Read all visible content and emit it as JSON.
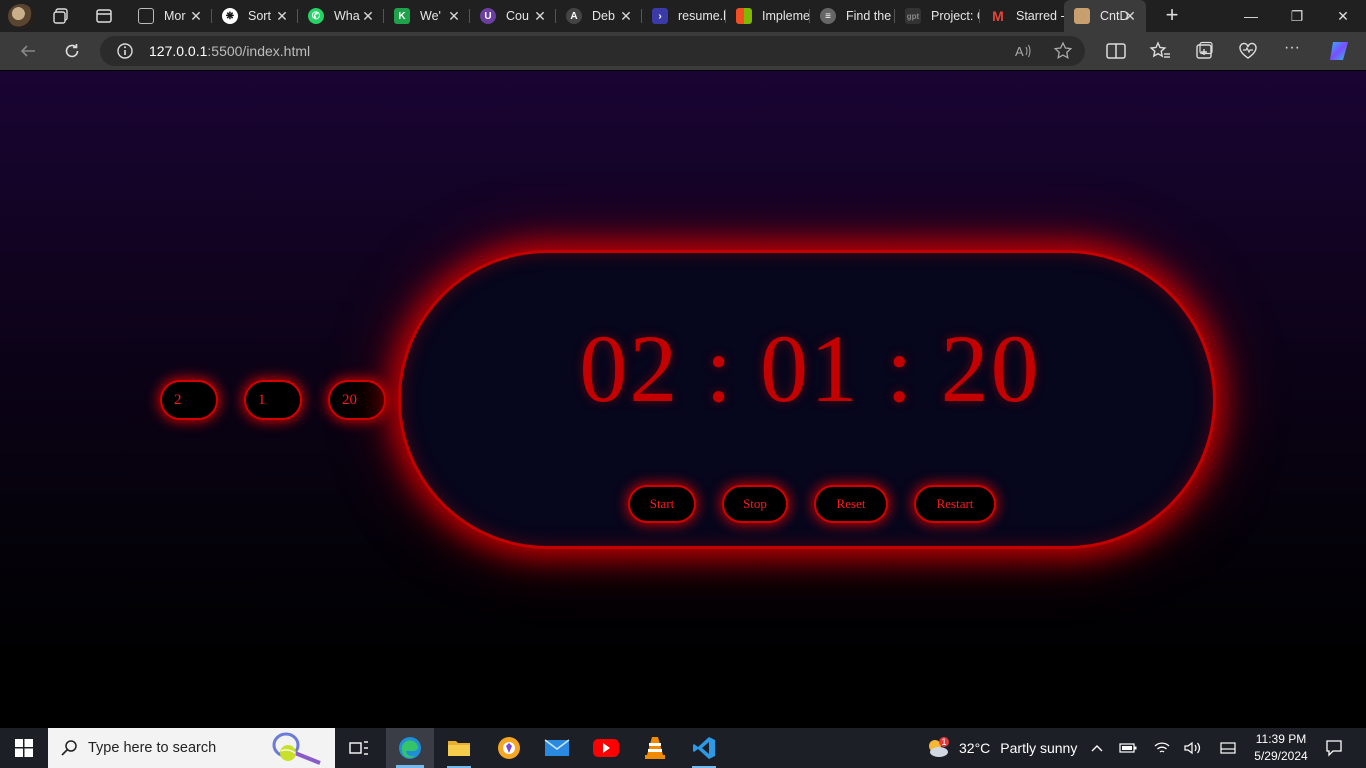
{
  "browser": {
    "tabs": [
      {
        "title": "Mor",
        "icon": "document-icon",
        "color": "#2b2b2b"
      },
      {
        "title": "Sort",
        "icon": "chatgpt-icon",
        "color": "#ffffff"
      },
      {
        "title": "Wha",
        "icon": "whatsapp-icon",
        "color": "#25d366"
      },
      {
        "title": "We'",
        "icon": "brand-icon",
        "color": "#1fa34a"
      },
      {
        "title": "Cou",
        "icon": "shield-icon",
        "color": "#6b3fa0"
      },
      {
        "title": "Deb",
        "icon": "a-logo-icon",
        "color": "#444444"
      },
      {
        "title": "resume.lc",
        "icon": "code-icon",
        "color": "#3a3aa8"
      },
      {
        "title": "Impleme",
        "icon": "windows-grid-icon",
        "color": "#f25022"
      },
      {
        "title": "Find the",
        "icon": "stack-icon",
        "color": "#777777"
      },
      {
        "title": "Project: C",
        "icon": "gpt-icon",
        "color": "#444444"
      },
      {
        "title": "Starred -",
        "icon": "gmail-icon",
        "color": "#ea4335"
      },
      {
        "title": "CntD",
        "icon": "site-icon",
        "color": "#c8a070",
        "active": true
      }
    ],
    "url_host": "127.0.0.1",
    "url_path": ":5500/index.html"
  },
  "app": {
    "timer_display": "02 : 01 : 20",
    "inputs": {
      "hours": "2",
      "minutes": "1",
      "seconds": "20"
    },
    "buttons": {
      "start": "Start",
      "stop": "Stop",
      "reset": "Reset",
      "restart": "Restart"
    },
    "accent_color": "#c40000"
  },
  "taskbar": {
    "search_placeholder": "Type here to search",
    "weather_temp": "32°C",
    "weather_text": "Partly sunny",
    "weather_badge": "1",
    "time": "11:39 PM",
    "date": "5/29/2024"
  }
}
